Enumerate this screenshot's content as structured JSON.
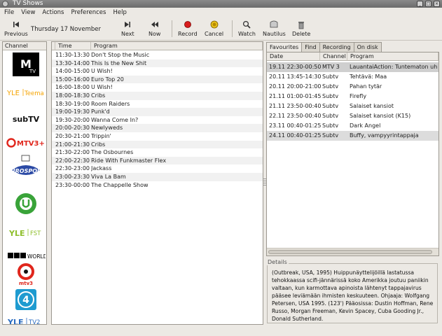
{
  "window": {
    "title": "TV Shows"
  },
  "menu": [
    "File",
    "View",
    "Actions",
    "Preferences",
    "Help"
  ],
  "toolbar": {
    "previous": "Previous",
    "date": "Thursday 17 November",
    "next": "Next",
    "now": "Now",
    "record": "Record",
    "cancel": "Cancel",
    "watch": "Watch",
    "nautilus": "Nautilus",
    "delete": "Delete"
  },
  "channels": {
    "header": "Channel",
    "logos": [
      "MTV",
      "YLE Teema",
      "subTV",
      "MTV3+",
      "Eurosport",
      "Urheilu",
      "YLE FST",
      "BBC World",
      "MTV3",
      "Nelonen",
      "YLE TV2"
    ]
  },
  "schedule": {
    "columns": [
      "Time",
      "Program"
    ],
    "rows": [
      [
        "11:30-13:30",
        "Don't Stop the Music"
      ],
      [
        "13:30-14:00",
        "This Is the New Shit"
      ],
      [
        "14:00-15:00",
        "U Wish!"
      ],
      [
        "15:00-16:00",
        "Euro Top 20"
      ],
      [
        "16:00-18:00",
        "U Wish!"
      ],
      [
        "18:00-18:30",
        "Cribs"
      ],
      [
        "18:30-19:00",
        "Room Raiders"
      ],
      [
        "19:00-19:30",
        "Punk'd"
      ],
      [
        "19:30-20:00",
        "Wanna Come In?"
      ],
      [
        "20:00-20:30",
        "Newlyweds"
      ],
      [
        "20:30-21:00",
        "Trippin'"
      ],
      [
        "21:00-21:30",
        "Cribs"
      ],
      [
        "21:30-22:00",
        "The Osbournes"
      ],
      [
        "22:00-22:30",
        "Ride With Funkmaster Flex"
      ],
      [
        "22:30-23:00",
        "Jackass"
      ],
      [
        "23:00-23:30",
        "Viva La Bam"
      ],
      [
        "23:30-00:00",
        "The Chappelle Show"
      ]
    ]
  },
  "tabs": [
    "Favourites",
    "Find",
    "Recording",
    "On disk"
  ],
  "favourites": {
    "columns": [
      "Date",
      "Channel",
      "Program"
    ],
    "rows": [
      [
        "19.11 22:30-00:50",
        "MTV 3",
        "LauantaiAction: Tuntematon uhk"
      ],
      [
        "20.11 13:45-14:30",
        "Subtv",
        "Tehtävä: Maa"
      ],
      [
        "20.11 20:00-21:00",
        "Subtv",
        "Pahan tytär"
      ],
      [
        "21.11 01:00-01:45",
        "Subtv",
        "Firefly"
      ],
      [
        "21.11 23:50-00:40",
        "Subtv",
        "Salaiset kansiot"
      ],
      [
        "22.11 23:50-00:40",
        "Subtv",
        "Salaiset kansiot (K15)"
      ],
      [
        "23.11 00:40-01:25",
        "Subtv",
        "Dark Angel"
      ],
      [
        "24.11 00:40-01:25",
        "Subtv",
        "Buffy, vampyyrintappaja"
      ]
    ],
    "selected_index": 0
  },
  "details": {
    "label": "Details",
    "text": "(Outbreak, USA, 1995) Huippunäyttelijöillä lastatussa tehokkaassa scifi-jännärissä koko Amerikka joutuu paniikin valtaan, kun karmottava apinoista lähtenyt tappajavirus pääsee leviämään ihmisten keskuuteen. Ohjaaja: Wolfgang Petersen, USA 1995. (123') Pääosissa: Dustin Hoffman, Rene Russo, Morgan Freeman, Kevin Spacey, Cuba Gooding Jr., Donald Sutherland."
  },
  "colors": {
    "selected_row": "#cfcfcf",
    "highlight_row": "#dcdcdc"
  }
}
